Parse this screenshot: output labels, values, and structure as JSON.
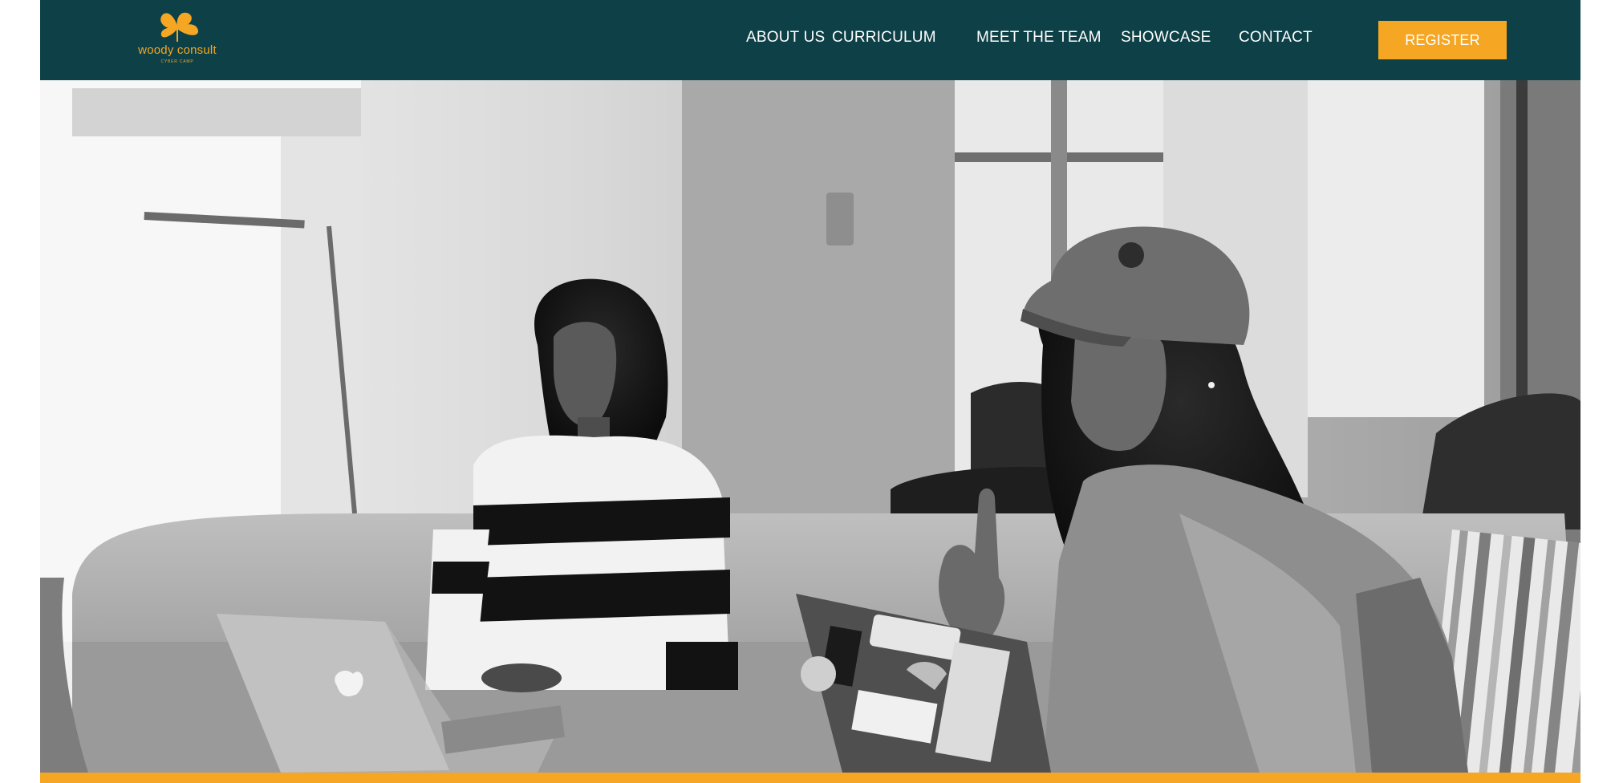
{
  "brand": {
    "name": "woody consult",
    "tagline": "CYBER CAMP",
    "logo_icon": "ginkgo-leaf-icon",
    "accent_color": "#f5a623",
    "nav_background": "#0d4147"
  },
  "nav": {
    "items": [
      {
        "label": "ABOUT US"
      },
      {
        "label": "CURRICULUM"
      },
      {
        "label": "MEET THE TEAM"
      },
      {
        "label": "SHOWCASE"
      },
      {
        "label": "CONTACT"
      }
    ],
    "register_label": "REGISTER"
  },
  "hero": {
    "image_alt": "Two women sitting on a couch with laptops, one wearing a camo cap and jacket speaking",
    "tone": "black-and-white photograph"
  }
}
